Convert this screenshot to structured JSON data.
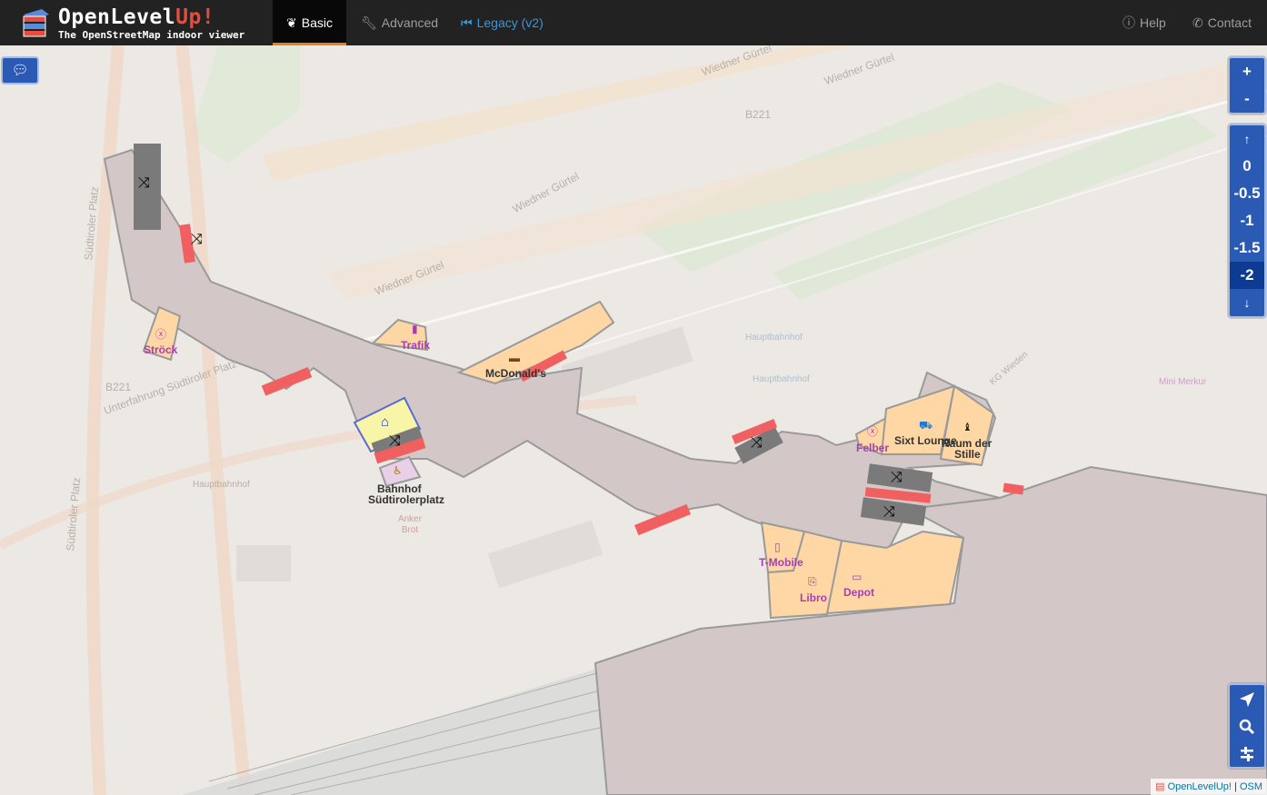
{
  "brand": {
    "title_part1": "Open",
    "title_part2": "Level",
    "title_part3": "Up!",
    "subtitle": "The OpenStreetMap indoor viewer"
  },
  "nav": {
    "basic": "Basic",
    "advanced": "Advanced",
    "legacy": "Legacy (v2)",
    "help": "Help",
    "contact": "Contact"
  },
  "zoom": {
    "in": "+",
    "out": "-"
  },
  "levels": {
    "up": "↑",
    "down": "↓",
    "items": [
      "0",
      "-0.5",
      "-1",
      "-1.5",
      "-2"
    ],
    "selected": "-2"
  },
  "tools": {
    "locate": "locate-icon",
    "search": "search-icon",
    "filter": "filter-icon"
  },
  "map_labels": {
    "strock": "Ströck",
    "trafik": "Trafik",
    "mcdonalds": "McDonald's",
    "bahnhof_line1": "Bahnhof",
    "bahnhof_line2": "Südtirolerplatz",
    "felber": "Felber",
    "sixt": "Sixt Lounge",
    "raum_line1": "Raum der",
    "raum_line2": "Stille",
    "tmobile": "T-Mobile",
    "libro": "Libro",
    "depot": "Depot"
  },
  "basemap_labels": {
    "wiedner1": "Wiedner Gürtel",
    "wiedner2": "Wiedner Gürtel",
    "wiedner3": "Wiedner Gürtel",
    "wiedner4": "Wiedner Gürtel",
    "b221a": "B221",
    "b221b": "B221",
    "sudtiroler1": "Südtiroler Platz",
    "sudtiroler2": "Südtiroler Platz",
    "unterfuhrung": "Unterfahrung Südtiroler Platz",
    "hauptbahnhof1": "Hauptbahnhof",
    "hauptbahnhof2": "Hauptbahnhof",
    "hauptbahnhof3": "Hauptbahnhof",
    "mini_merkur": "Mini Merkur",
    "kg_wieden": "KG Wieden",
    "anker": "Anker Brot"
  },
  "attribution": {
    "link1": "OpenLevelUp!",
    "separator": " | ",
    "link2": "OSM"
  },
  "colors": {
    "navbar": "#222222",
    "accent": "#e67e22",
    "control_blue": "#2a5ab3",
    "shop_label": "#a73fb3",
    "shop_fill": "#fed7a5",
    "corridor": "#d3c7c7"
  }
}
